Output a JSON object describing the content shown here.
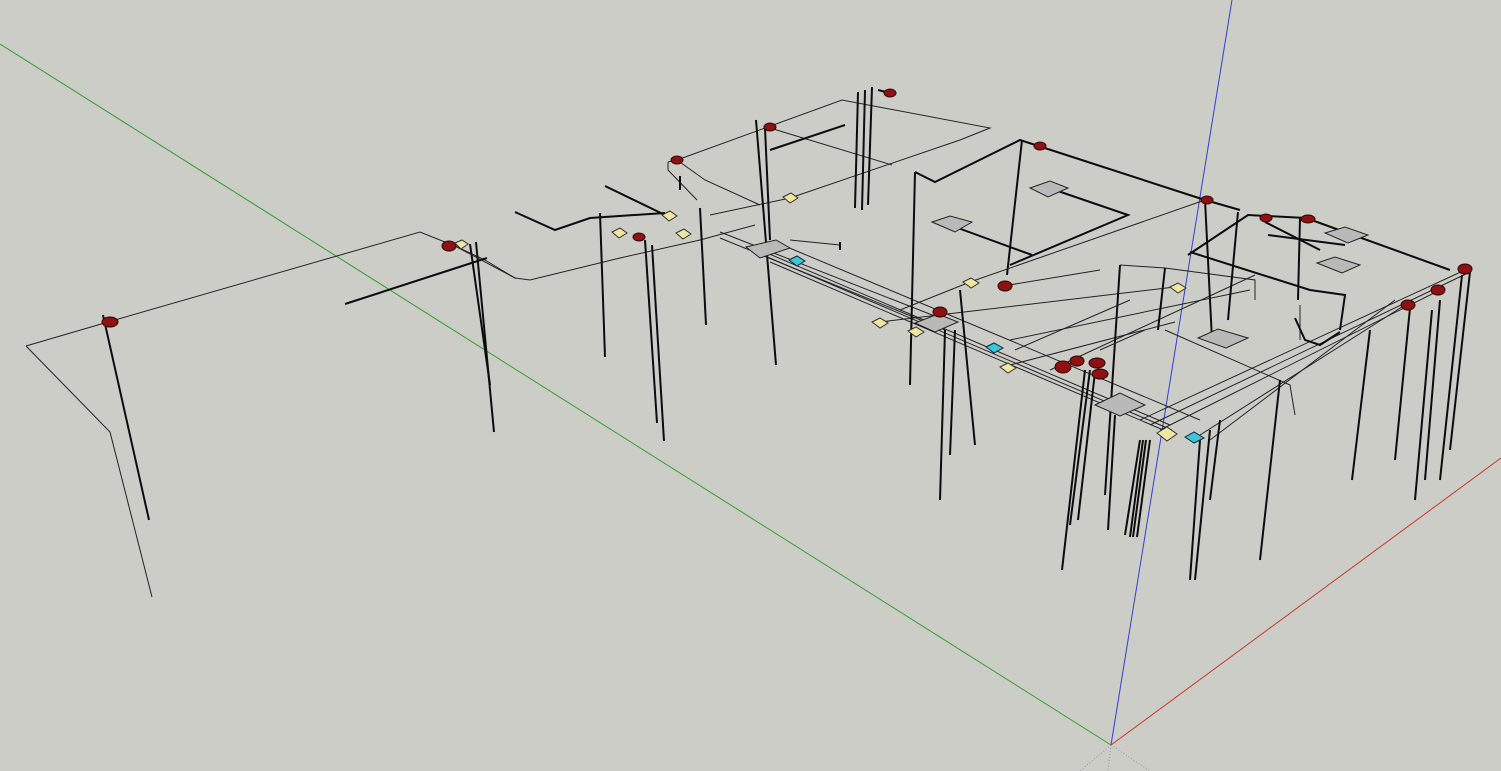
{
  "viewport": {
    "background": "#cdcdc8",
    "axes": {
      "red_axis_color": "#c43a2e",
      "green_axis_color": "#2fa02f",
      "blue_axis_color": "#2f3fd6",
      "origin_guide_color": "#9a9a9a"
    },
    "component_colors": {
      "red_fixture": "#8e1212",
      "yellow_box": "#efe6a0",
      "cyan_box": "#3cc8d2",
      "grey_panel": "#b9b9b9",
      "wire": "#111111"
    },
    "component_icons": {
      "red_fixture": "red-light-fixture-icon",
      "yellow_box": "junction-box-icon",
      "cyan_box": "outlet-box-icon",
      "grey_panel": "panel-icon"
    }
  }
}
